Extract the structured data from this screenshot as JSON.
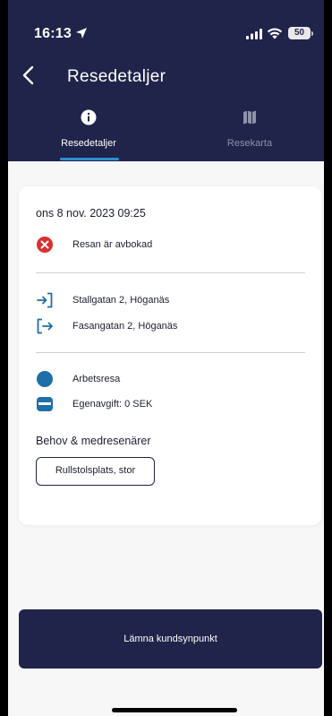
{
  "status_bar": {
    "time": "16:13",
    "battery": "50"
  },
  "header": {
    "title": "Resedetaljer"
  },
  "tabs": [
    {
      "label": "Resedetaljer",
      "icon": "info-icon",
      "active": true
    },
    {
      "label": "Resekarta",
      "icon": "map-icon",
      "active": false
    }
  ],
  "trip": {
    "datetime": "ons 8 nov. 2023 09:25",
    "status": "Resan är avbokad",
    "from": "Stallgatan 2, Höganäs",
    "to": "Fasangatan 2, Höganäs",
    "trip_type": "Arbetsresa",
    "fee": "Egenavgift: 0 SEK",
    "needs_title": "Behov & medresenärer",
    "needs": [
      "Rullstolsplats, stor"
    ]
  },
  "actions": {
    "feedback_label": "Lämna kundsynpunkt"
  },
  "colors": {
    "header_bg": "#20244a",
    "accent": "#2d8fd0",
    "cancel_red": "#d9302f",
    "icon_blue": "#1e6fa8"
  }
}
